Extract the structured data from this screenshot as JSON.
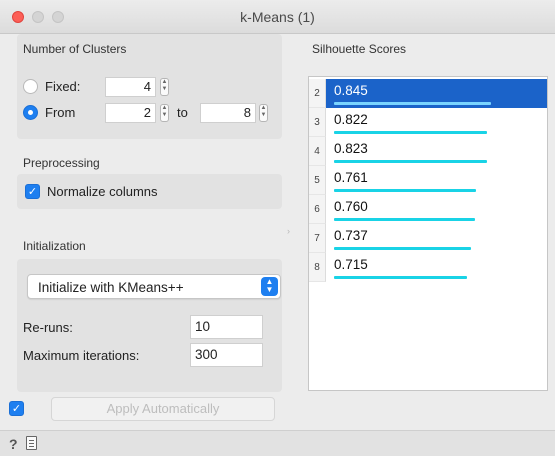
{
  "window": {
    "title": "k-Means (1)"
  },
  "clusters": {
    "title": "Number of Clusters",
    "fixed_label": "Fixed:",
    "fixed_value": "4",
    "from_label": "From",
    "from_value": "2",
    "to_label": "to",
    "to_value": "8",
    "selected_mode": "From"
  },
  "preprocessing": {
    "title": "Preprocessing",
    "normalize_label": "Normalize columns",
    "normalize_checked": true
  },
  "initialization": {
    "title": "Initialization",
    "method": "Initialize with KMeans++",
    "reruns_label": "Re-runs:",
    "reruns_value": "10",
    "max_iter_label": "Maximum iterations:",
    "max_iter_value": "300"
  },
  "silhouette": {
    "title": "Silhouette Scores",
    "rows": [
      {
        "k": "2",
        "score": "0.845",
        "selected": true
      },
      {
        "k": "3",
        "score": "0.822",
        "selected": false
      },
      {
        "k": "4",
        "score": "0.823",
        "selected": false
      },
      {
        "k": "5",
        "score": "0.761",
        "selected": false
      },
      {
        "k": "6",
        "score": "0.760",
        "selected": false
      },
      {
        "k": "7",
        "score": "0.737",
        "selected": false
      },
      {
        "k": "8",
        "score": "0.715",
        "selected": false
      }
    ]
  },
  "footer": {
    "apply_label": "Apply Automatically",
    "auto_apply_checked": true,
    "help_label": "?"
  },
  "colors": {
    "accent": "#1e7ff0",
    "selection": "#1b63c9",
    "score_bar": "#19d3e6"
  }
}
